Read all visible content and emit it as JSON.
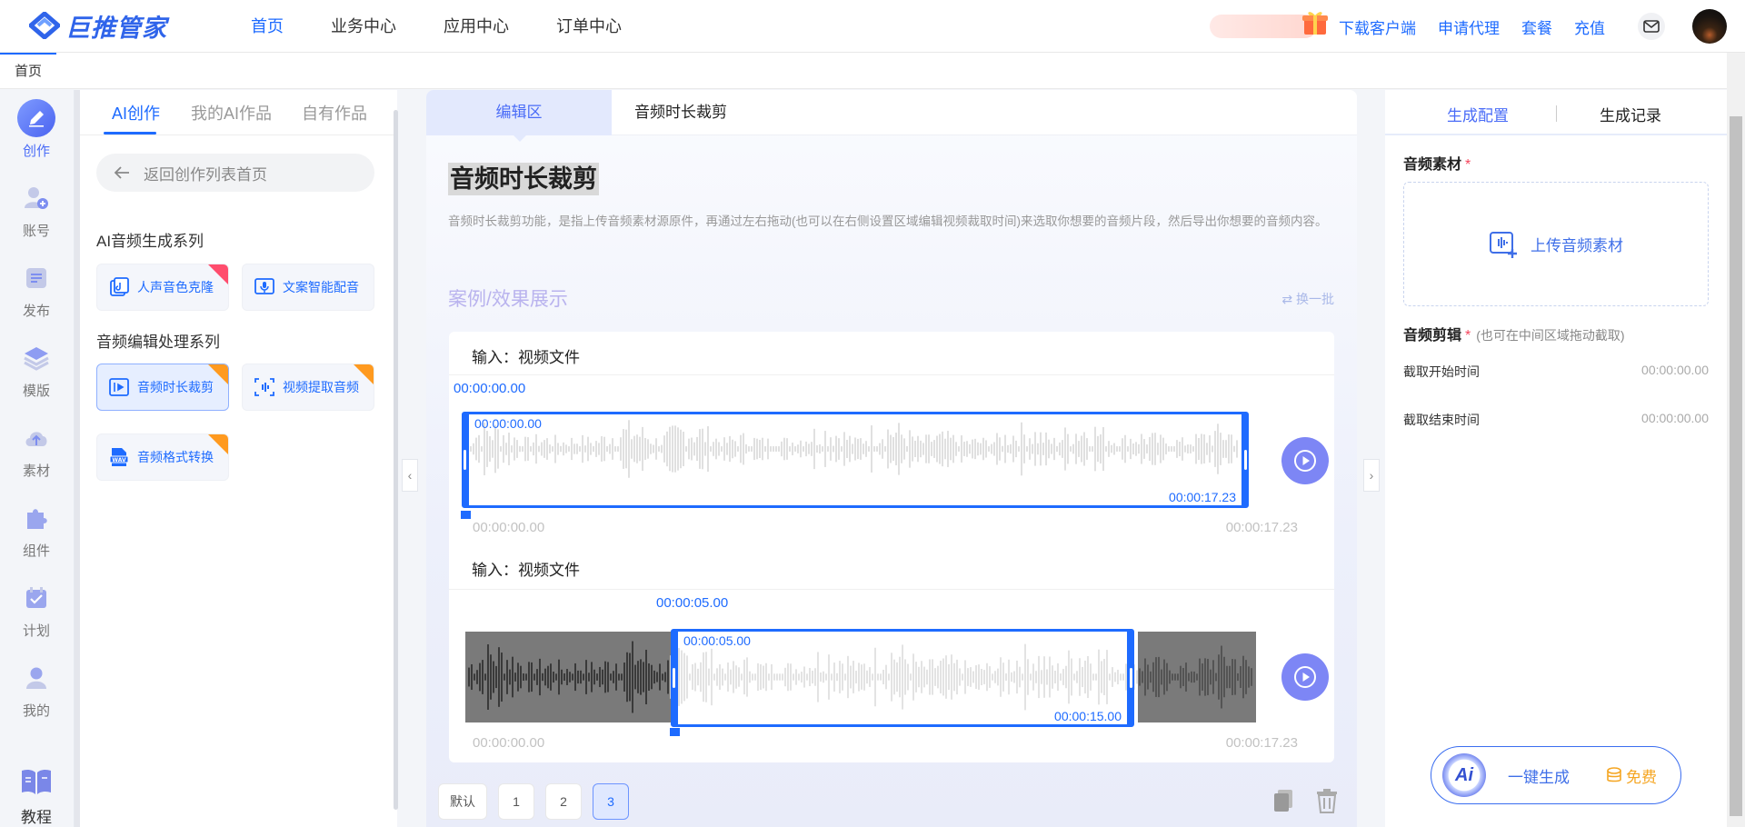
{
  "app": {
    "logo_text": "巨推管家"
  },
  "nav": {
    "items": [
      "首页",
      "业务中心",
      "应用中心",
      "订单中心"
    ],
    "active": 0
  },
  "top_links": [
    "下载客户端",
    "申请代理",
    "套餐",
    "充值"
  ],
  "tabbar": {
    "home": "首页"
  },
  "rail": {
    "items": [
      "创作",
      "账号",
      "发布",
      "模版",
      "素材",
      "组件",
      "计划",
      "我的"
    ],
    "tutorial": "教程"
  },
  "left_panel": {
    "tabs": [
      "AI创作",
      "我的AI作品",
      "自有作品"
    ],
    "back_label": "返回创作列表首页",
    "section1": "AI音频生成系列",
    "section1_tools": [
      {
        "label": "人声音色克隆",
        "icon": "voice-clone-icon",
        "badge": "hot"
      },
      {
        "label": "文案智能配音",
        "icon": "dubbing-icon"
      }
    ],
    "section2": "音频编辑处理系列",
    "section2_tools": [
      {
        "label": "音频时长裁剪",
        "icon": "audio-trim-icon",
        "badge": "new"
      },
      {
        "label": "视频提取音频",
        "icon": "extract-audio-icon",
        "badge": "new"
      },
      {
        "label": "音频格式转换",
        "icon": "wav-icon",
        "badge": "new"
      }
    ]
  },
  "center": {
    "tabs": [
      "编辑区",
      "音频时长裁剪"
    ],
    "title": "音频时长裁剪",
    "description": "音频时长裁剪功能，是指上传音频素材源原件，再通过左右拖动(也可以在右侧设置区域编辑视频裁取时间)来选取你想要的音频片段，然后导出你想要的音频内容。",
    "case_title": "案例/效果展示",
    "swap_label": "换一批",
    "examples": [
      {
        "input_label": "输入：视频文件",
        "cursor_time": "00:00:00.00",
        "sel_start": "00:00:00.00",
        "sel_end": "00:00:17.23",
        "axis_start": "00:00:00.00",
        "axis_end": "00:00:17.23"
      },
      {
        "input_label": "输入：视频文件",
        "cursor_time": "00:00:05.00",
        "sel_start": "00:00:05.00",
        "sel_end": "00:00:15.00",
        "axis_start": "00:00:00.00",
        "axis_end": "00:00:17.23"
      }
    ],
    "pager": [
      "默认",
      "1",
      "2",
      "3"
    ],
    "pager_active": 3
  },
  "right_panel": {
    "tabs": [
      "生成配置",
      "生成记录"
    ],
    "audio_label": "音频素材",
    "upload_label": "上传音频素材",
    "edit_label": "音频剪辑",
    "edit_hint": "(也可在中间区域拖动截取)",
    "start_label": "截取开始时间",
    "start_value": "00:00:00.00",
    "end_label": "截取结束时间",
    "end_value": "00:00:00.00",
    "generate_label": "一键生成",
    "free_label": "免费",
    "ai_badge": "Ai",
    "required_mark": "*"
  },
  "colors": {
    "accent": "#1e6bff",
    "play": "#7d86f5",
    "badge_hot": "#ff4d6d",
    "badge_new": "#ff9a1f"
  }
}
